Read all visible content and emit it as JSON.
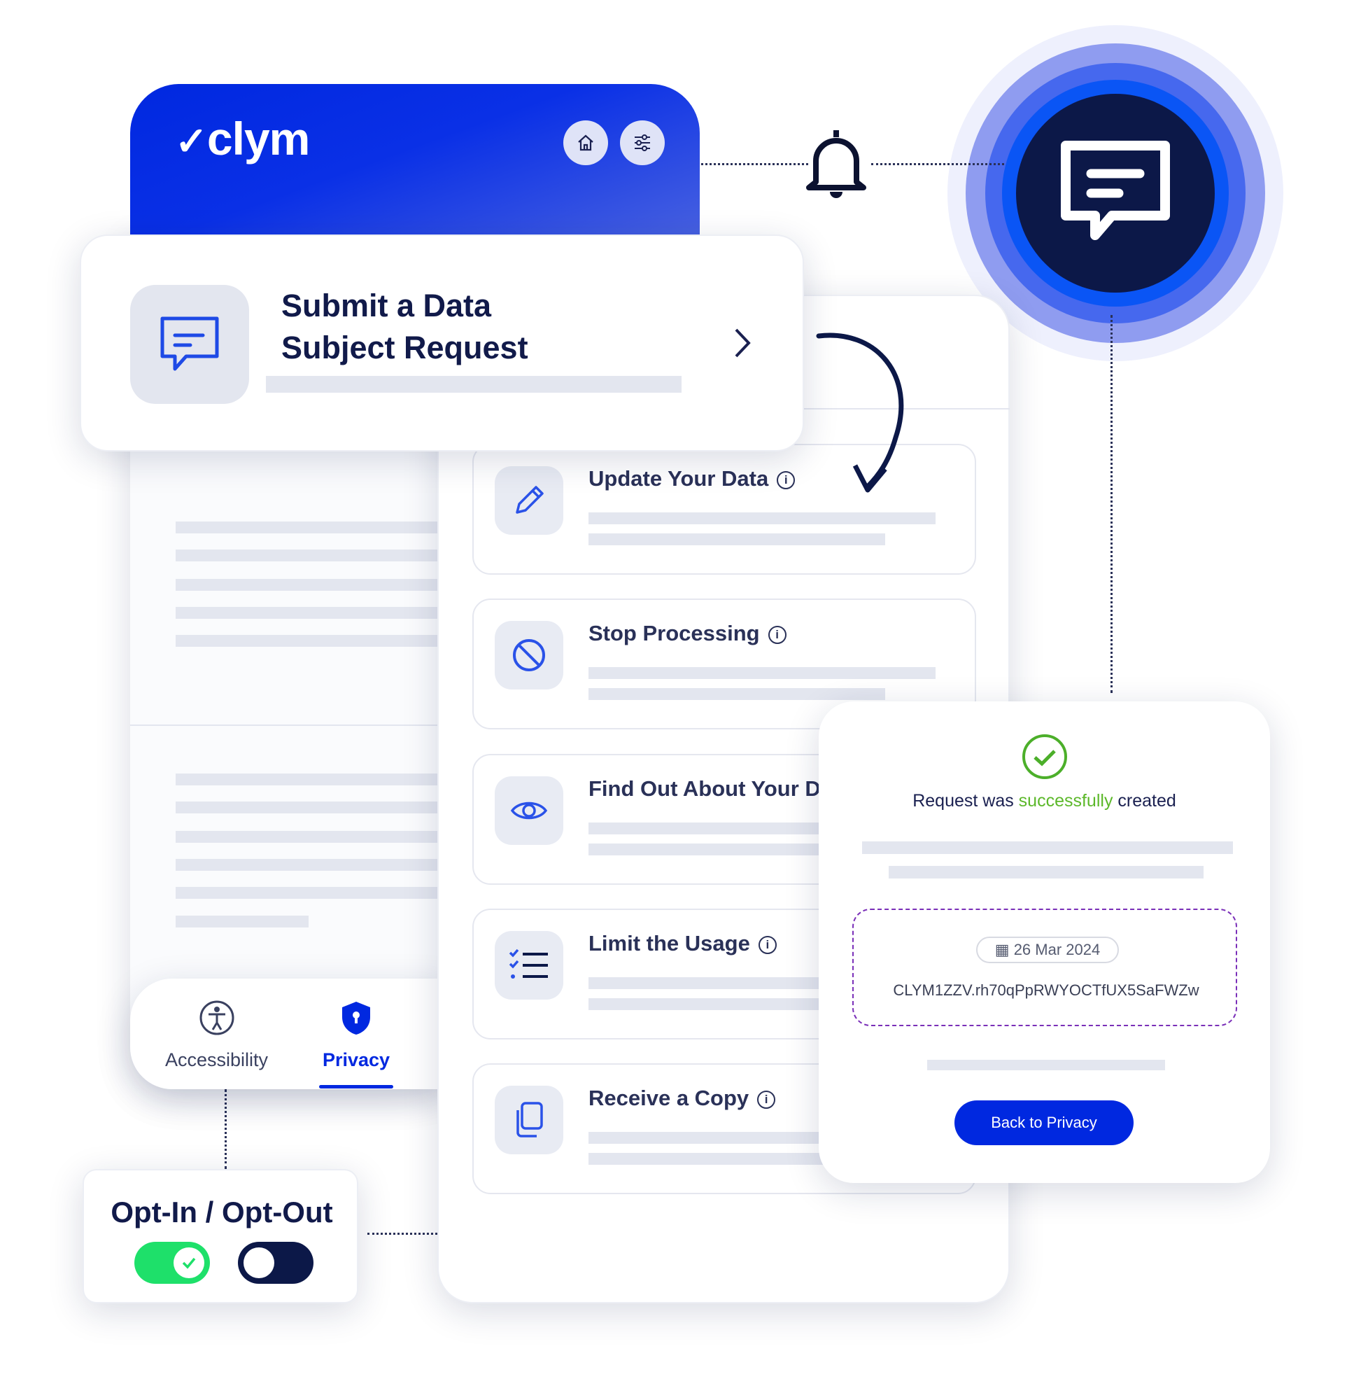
{
  "header": {
    "logo": "clym",
    "home_icon": "home-icon",
    "settings_icon": "sliders-icon",
    "brand_color": "#0028e0"
  },
  "submit_card": {
    "title_line1": "Submit a Data",
    "title_line2": "Subject Request",
    "icon": "chat-icon"
  },
  "request_types": [
    {
      "label": "Update Your Data",
      "icon": "pencil-icon"
    },
    {
      "label": "Stop Processing",
      "icon": "ban-icon"
    },
    {
      "label": "Find Out About Your Da",
      "icon": "eye-icon"
    },
    {
      "label": "Limit the Usage",
      "icon": "checklist-icon"
    },
    {
      "label": "Receive a Copy",
      "icon": "copy-icon"
    }
  ],
  "success": {
    "text_before": "Request was ",
    "text_highlight": "successfully",
    "text_after": " created",
    "highlight_color": "#5cb82a",
    "date": "26 Mar 2024",
    "request_id": "CLYM1ZZV.rh70qPpRWYOCTfUX5SaFWZw",
    "button": "Back to Privacy"
  },
  "tabs": [
    {
      "label": "Accessibility",
      "active": false
    },
    {
      "label": "Privacy",
      "active": true
    }
  ],
  "opt": {
    "title": "Opt-In / Opt-Out",
    "toggle_on": true,
    "toggle_off": false
  }
}
